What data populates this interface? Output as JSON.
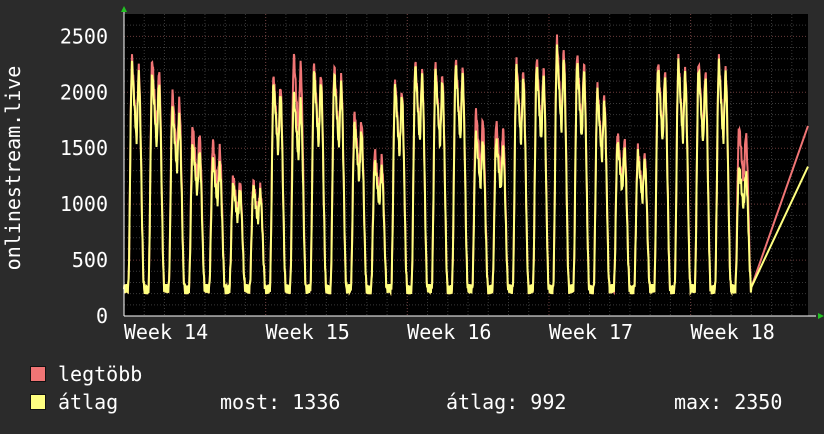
{
  "chart_data": {
    "type": "line",
    "ylabel": "onlinestream.live",
    "ylim": [
      0,
      2700
    ],
    "yticks": [
      0,
      500,
      1000,
      1500,
      2000,
      2500
    ],
    "xticks": [
      "Week 14",
      "Week 15",
      "Week 16",
      "Week 17",
      "Week 18"
    ],
    "x_range_days": [
      0,
      33.8
    ],
    "grid": true,
    "colors": {
      "background": "#2b2b2b",
      "plot": "#000000",
      "grid": "#3a3a3a",
      "max": "#f07575",
      "avg": "#ffff80"
    },
    "daily_peaks": {
      "max": [
        2310,
        2300,
        2000,
        1700,
        1560,
        1250,
        1200,
        2150,
        2340,
        2260,
        2230,
        1820,
        1480,
        2100,
        2280,
        2250,
        2300,
        1830,
        1740,
        2280,
        2310,
        2480,
        2350,
        2050,
        1640,
        1500,
        2280,
        2300,
        2280,
        2300,
        1700
      ],
      "avg": [
        2250,
        2180,
        1850,
        1540,
        1400,
        1180,
        1150,
        2080,
        2000,
        2190,
        2160,
        1730,
        1380,
        2060,
        2240,
        2190,
        2250,
        1630,
        1580,
        2220,
        2240,
        2390,
        2280,
        2000,
        1560,
        1450,
        2230,
        2260,
        2220,
        2260,
        1336
      ]
    },
    "series": [
      {
        "name": "legtöbb",
        "color": "#f07575"
      },
      {
        "name": "átlag",
        "color": "#ffff80"
      }
    ]
  },
  "legend": {
    "max_label": "legtöbb",
    "avg_label": "átlag",
    "now_label": "most: 1336",
    "avg_value_label": "átlag: 992",
    "max_value_label": "max: 2350"
  }
}
